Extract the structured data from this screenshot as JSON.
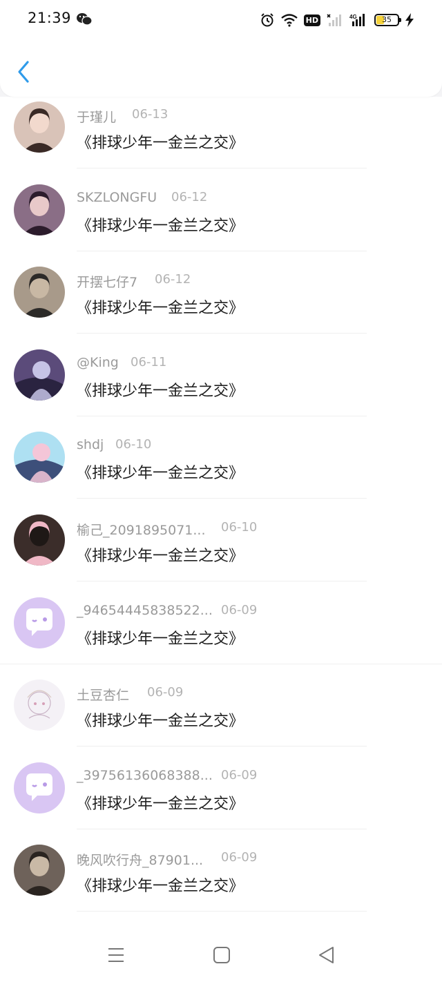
{
  "status_bar": {
    "time": "21:39",
    "battery_level": "35",
    "hd_label": "HD",
    "network_label": "4G",
    "icons": [
      "wechat-icon",
      "alarm-icon",
      "wifi-icon",
      "hd-badge",
      "signal-icon",
      "signal-icon",
      "battery-icon",
      "charging-icon"
    ]
  },
  "header": {
    "back_icon": "chevron-left-icon"
  },
  "comments": [
    {
      "username": "于瑾儿",
      "date": "06-13",
      "text": "《排球少年一金兰之交》",
      "avatar": "photo"
    },
    {
      "username": "SKZLONGFU",
      "date": "06-12",
      "text": "《排球少年一金兰之交》",
      "avatar": "photo"
    },
    {
      "username": "开摆七仔7",
      "date": "06-12",
      "text": "《排球少年一金兰之交》",
      "avatar": "photo"
    },
    {
      "username": "@King",
      "date": "06-11",
      "text": "《排球少年一金兰之交》",
      "avatar": "anime"
    },
    {
      "username": "shdj",
      "date": "06-10",
      "text": "《排球少年一金兰之交》",
      "avatar": "anime"
    },
    {
      "username": "榆己_2091895071...",
      "date": "06-10",
      "text": "《排球少年一金兰之交》",
      "avatar": "photo"
    },
    {
      "username": "_94654445838522...",
      "date": "06-09",
      "text": "《排球少年一金兰之交》",
      "avatar": "default"
    },
    {
      "username": "土豆杏仁",
      "date": "06-09",
      "text": "《排球少年一金兰之交》",
      "avatar": "sketch"
    },
    {
      "username": "_39756136068388...",
      "date": "06-09",
      "text": "《排球少年一金兰之交》",
      "avatar": "default"
    },
    {
      "username": "晚风吹行舟_87901...",
      "date": "06-09",
      "text": "《排球少年一金兰之交》",
      "avatar": "photo"
    }
  ],
  "nav_bar": {
    "icons": [
      "menu-icon",
      "home-icon",
      "back-icon"
    ]
  },
  "colors": {
    "accent": "#2f9bea",
    "default_avatar": "#d9c6f3",
    "username": "#9a9a9a",
    "text": "#1f1f1f"
  }
}
